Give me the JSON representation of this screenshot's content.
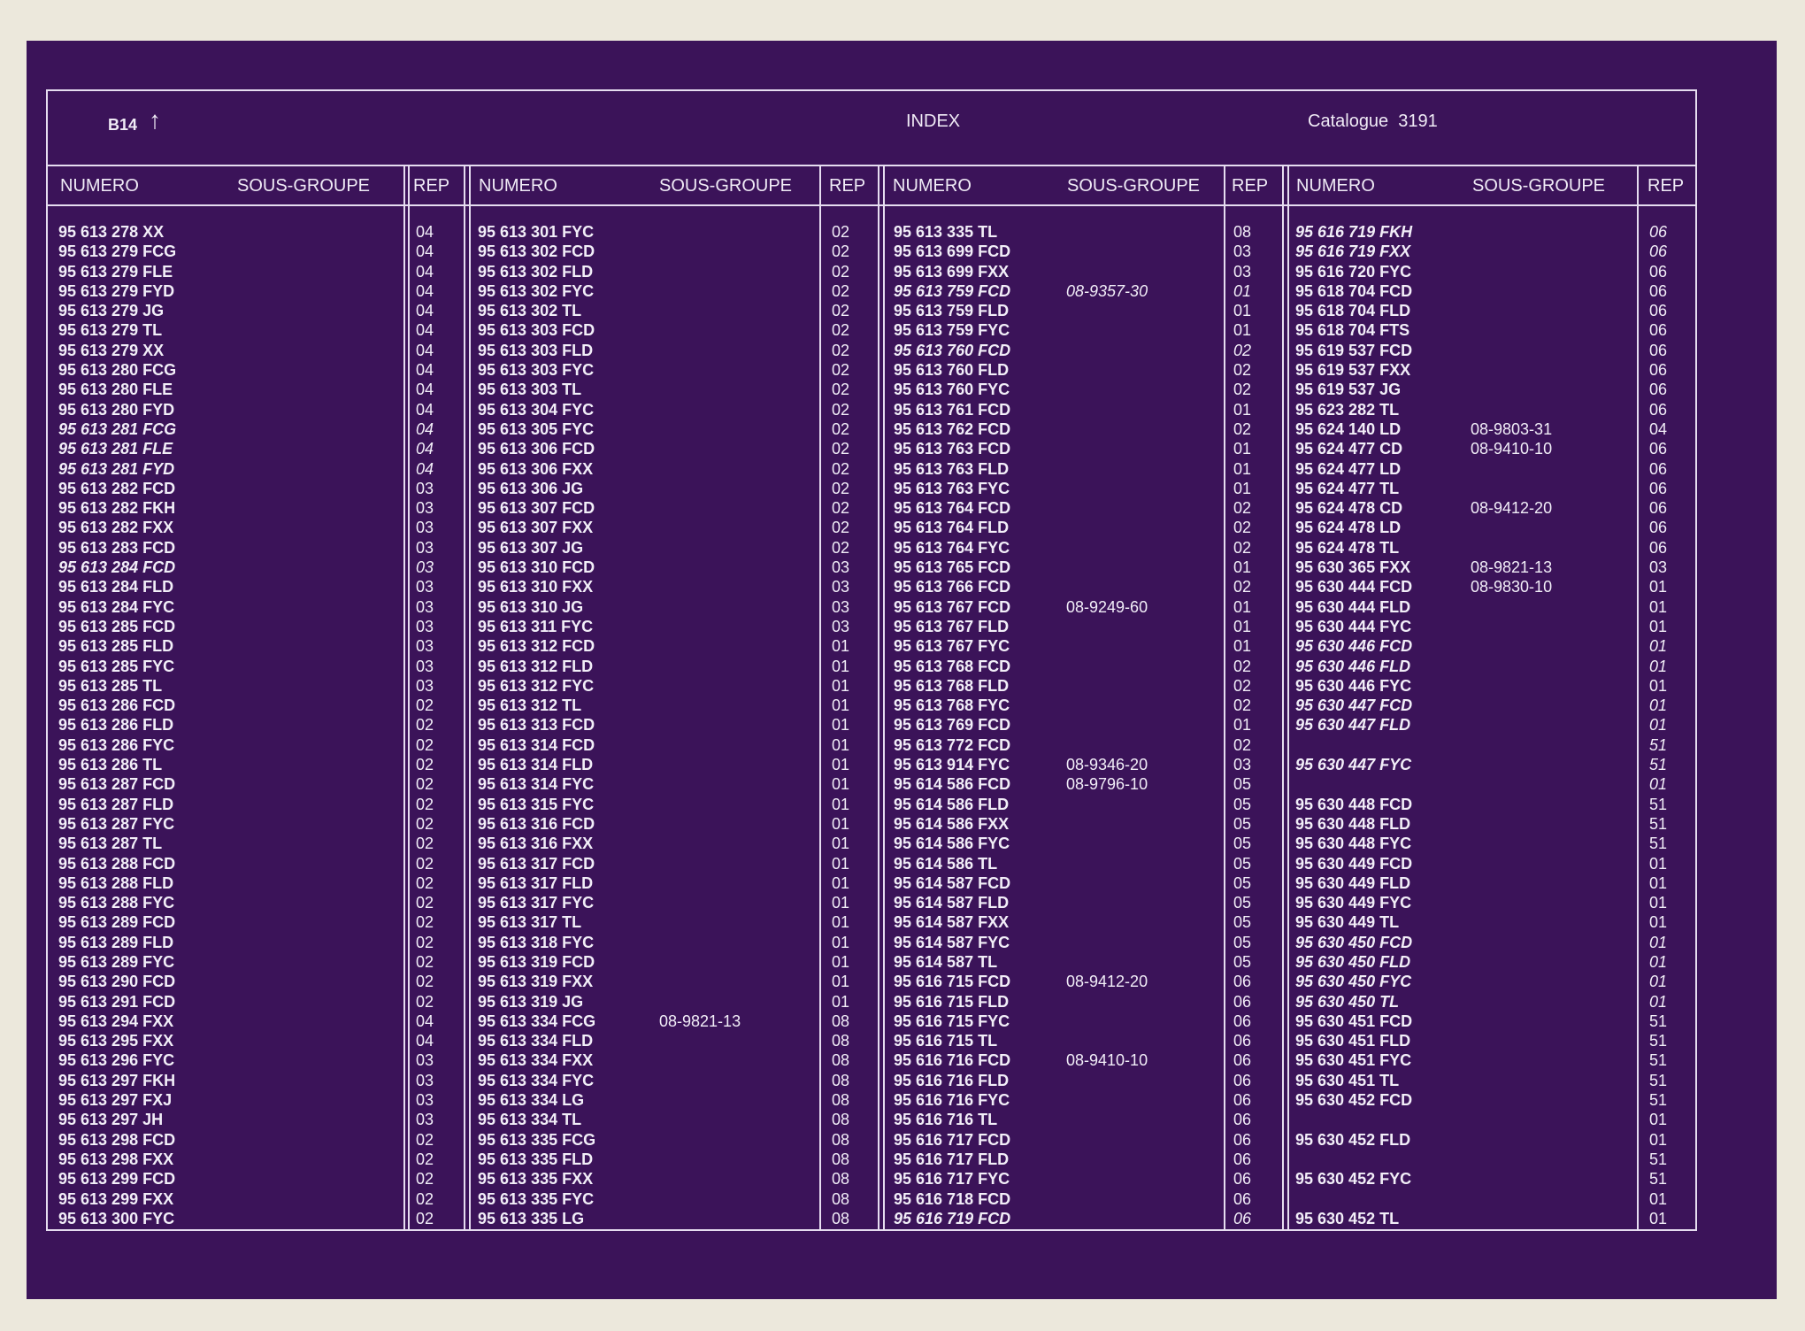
{
  "header": {
    "page_code": "B14",
    "arrow": "↑",
    "title": "INDEX",
    "catalogue": "Catalogue  3191"
  },
  "columns": {
    "numero": "NUMERO",
    "sous_groupe": "SOUS-GROUPE",
    "rep": "REP"
  },
  "col1": [
    {
      "n": "95 613 278 XX",
      "s": "",
      "r": "04"
    },
    {
      "n": "95 613 279 FCG",
      "s": "",
      "r": "04"
    },
    {
      "n": "95 613 279 FLE",
      "s": "",
      "r": "04"
    },
    {
      "n": "95 613 279 FYD",
      "s": "",
      "r": "04"
    },
    {
      "n": "95 613 279 JG",
      "s": "",
      "r": "04"
    },
    {
      "n": "95 613 279 TL",
      "s": "",
      "r": "04"
    },
    {
      "n": "95 613 279 XX",
      "s": "",
      "r": "04"
    },
    {
      "n": "95 613 280 FCG",
      "s": "",
      "r": "04"
    },
    {
      "n": "95 613 280 FLE",
      "s": "",
      "r": "04"
    },
    {
      "n": "95 613 280 FYD",
      "s": "",
      "r": "04"
    },
    {
      "n": "95 613 281 FCG",
      "s": "",
      "r": "04",
      "i": true
    },
    {
      "n": "95 613 281 FLE",
      "s": "",
      "r": "04",
      "i": true
    },
    {
      "n": "95 613 281 FYD",
      "s": "",
      "r": "04",
      "i": true
    },
    {
      "n": "95 613 282 FCD",
      "s": "",
      "r": "03"
    },
    {
      "n": "95 613 282 FKH",
      "s": "",
      "r": "03"
    },
    {
      "n": "95 613 282 FXX",
      "s": "",
      "r": "03"
    },
    {
      "n": "95 613 283 FCD",
      "s": "",
      "r": "03"
    },
    {
      "n": "95 613 284 FCD",
      "s": "",
      "r": "03",
      "i": true
    },
    {
      "n": "95 613 284 FLD",
      "s": "",
      "r": "03"
    },
    {
      "n": "95 613 284 FYC",
      "s": "",
      "r": "03"
    },
    {
      "n": "95 613 285 FCD",
      "s": "",
      "r": "03"
    },
    {
      "n": "95 613 285 FLD",
      "s": "",
      "r": "03"
    },
    {
      "n": "95 613 285 FYC",
      "s": "",
      "r": "03"
    },
    {
      "n": "95 613 285 TL",
      "s": "",
      "r": "03"
    },
    {
      "n": "95 613 286 FCD",
      "s": "",
      "r": "02"
    },
    {
      "n": "95 613 286 FLD",
      "s": "",
      "r": "02"
    },
    {
      "n": "95 613 286 FYC",
      "s": "",
      "r": "02"
    },
    {
      "n": "95 613 286 TL",
      "s": "",
      "r": "02"
    },
    {
      "n": "95 613 287 FCD",
      "s": "",
      "r": "02"
    },
    {
      "n": "95 613 287 FLD",
      "s": "",
      "r": "02"
    },
    {
      "n": "95 613 287 FYC",
      "s": "",
      "r": "02"
    },
    {
      "n": "95 613 287 TL",
      "s": "",
      "r": "02"
    },
    {
      "n": "95 613 288 FCD",
      "s": "",
      "r": "02"
    },
    {
      "n": "95 613 288 FLD",
      "s": "",
      "r": "02"
    },
    {
      "n": "95 613 288 FYC",
      "s": "",
      "r": "02"
    },
    {
      "n": "95 613 289 FCD",
      "s": "",
      "r": "02"
    },
    {
      "n": "95 613 289 FLD",
      "s": "",
      "r": "02"
    },
    {
      "n": "95 613 289 FYC",
      "s": "",
      "r": "02"
    },
    {
      "n": "95 613 290 FCD",
      "s": "",
      "r": "02"
    },
    {
      "n": "95 613 291 FCD",
      "s": "",
      "r": "02"
    },
    {
      "n": "95 613 294 FXX",
      "s": "",
      "r": "04"
    },
    {
      "n": "95 613 295 FXX",
      "s": "",
      "r": "04"
    },
    {
      "n": "95 613 296 FYC",
      "s": "",
      "r": "03"
    },
    {
      "n": "95 613 297 FKH",
      "s": "",
      "r": "03"
    },
    {
      "n": "95 613 297 FXJ",
      "s": "",
      "r": "03"
    },
    {
      "n": "95 613 297 JH",
      "s": "",
      "r": "03"
    },
    {
      "n": "95 613 298 FCD",
      "s": "",
      "r": "02"
    },
    {
      "n": "95 613 298 FXX",
      "s": "",
      "r": "02"
    },
    {
      "n": "95 613 299 FCD",
      "s": "",
      "r": "02"
    },
    {
      "n": "95 613 299 FXX",
      "s": "",
      "r": "02"
    },
    {
      "n": "95 613 300 FYC",
      "s": "",
      "r": "02"
    }
  ],
  "col2": [
    {
      "n": "95 613 301 FYC",
      "s": "",
      "r": "02"
    },
    {
      "n": "95 613 302 FCD",
      "s": "",
      "r": "02"
    },
    {
      "n": "95 613 302 FLD",
      "s": "",
      "r": "02"
    },
    {
      "n": "95 613 302 FYC",
      "s": "",
      "r": "02"
    },
    {
      "n": "95 613 302 TL",
      "s": "",
      "r": "02"
    },
    {
      "n": "95 613 303 FCD",
      "s": "",
      "r": "02"
    },
    {
      "n": "95 613 303 FLD",
      "s": "",
      "r": "02"
    },
    {
      "n": "95 613 303 FYC",
      "s": "",
      "r": "02"
    },
    {
      "n": "95 613 303 TL",
      "s": "",
      "r": "02"
    },
    {
      "n": "95 613 304 FYC",
      "s": "",
      "r": "02"
    },
    {
      "n": "95 613 305 FYC",
      "s": "",
      "r": "02"
    },
    {
      "n": "95 613 306 FCD",
      "s": "",
      "r": "02"
    },
    {
      "n": "95 613 306 FXX",
      "s": "",
      "r": "02"
    },
    {
      "n": "95 613 306 JG",
      "s": "",
      "r": "02"
    },
    {
      "n": "95 613 307 FCD",
      "s": "",
      "r": "02"
    },
    {
      "n": "95 613 307 FXX",
      "s": "",
      "r": "02"
    },
    {
      "n": "95 613 307 JG",
      "s": "",
      "r": "02"
    },
    {
      "n": "95 613 310 FCD",
      "s": "",
      "r": "03"
    },
    {
      "n": "95 613 310 FXX",
      "s": "",
      "r": "03"
    },
    {
      "n": "95 613 310 JG",
      "s": "",
      "r": "03"
    },
    {
      "n": "95 613 311 FYC",
      "s": "",
      "r": "03"
    },
    {
      "n": "95 613 312 FCD",
      "s": "",
      "r": "01"
    },
    {
      "n": "95 613 312 FLD",
      "s": "",
      "r": "01"
    },
    {
      "n": "95 613 312 FYC",
      "s": "",
      "r": "01"
    },
    {
      "n": "95 613 312 TL",
      "s": "",
      "r": "01"
    },
    {
      "n": "95 613 313 FCD",
      "s": "",
      "r": "01"
    },
    {
      "n": "95 613 314 FCD",
      "s": "",
      "r": "01"
    },
    {
      "n": "95 613 314 FLD",
      "s": "",
      "r": "01"
    },
    {
      "n": "95 613 314 FYC",
      "s": "",
      "r": "01"
    },
    {
      "n": "95 613 315 FYC",
      "s": "",
      "r": "01"
    },
    {
      "n": "95 613 316 FCD",
      "s": "",
      "r": "01"
    },
    {
      "n": "95 613 316 FXX",
      "s": "",
      "r": "01"
    },
    {
      "n": "95 613 317 FCD",
      "s": "",
      "r": "01"
    },
    {
      "n": "95 613 317 FLD",
      "s": "",
      "r": "01"
    },
    {
      "n": "95 613 317 FYC",
      "s": "",
      "r": "01"
    },
    {
      "n": "95 613 317 TL",
      "s": "",
      "r": "01"
    },
    {
      "n": "95 613 318 FYC",
      "s": "",
      "r": "01"
    },
    {
      "n": "95 613 319 FCD",
      "s": "",
      "r": "01"
    },
    {
      "n": "95 613 319 FXX",
      "s": "",
      "r": "01"
    },
    {
      "n": "95 613 319 JG",
      "s": "",
      "r": "01"
    },
    {
      "n": "95 613 334 FCG",
      "s": "08-9821-13",
      "r": "08"
    },
    {
      "n": "95 613 334 FLD",
      "s": "",
      "r": "08"
    },
    {
      "n": "95 613 334 FXX",
      "s": "",
      "r": "08"
    },
    {
      "n": "95 613 334 FYC",
      "s": "",
      "r": "08"
    },
    {
      "n": "95 613 334 LG",
      "s": "",
      "r": "08"
    },
    {
      "n": "95 613 334 TL",
      "s": "",
      "r": "08"
    },
    {
      "n": "95 613 335 FCG",
      "s": "",
      "r": "08"
    },
    {
      "n": "95 613 335 FLD",
      "s": "",
      "r": "08"
    },
    {
      "n": "95 613 335 FXX",
      "s": "",
      "r": "08"
    },
    {
      "n": "95 613 335 FYC",
      "s": "",
      "r": "08"
    },
    {
      "n": "95 613 335 LG",
      "s": "",
      "r": "08"
    }
  ],
  "col3": [
    {
      "n": "95 613 335 TL",
      "s": "",
      "r": "08"
    },
    {
      "n": "95 613 699 FCD",
      "s": "",
      "r": "03"
    },
    {
      "n": "95 613 699 FXX",
      "s": "",
      "r": "03"
    },
    {
      "n": "95 613 759 FCD",
      "s": "08-9357-30",
      "r": "01",
      "i": true
    },
    {
      "n": "95 613 759 FLD",
      "s": "",
      "r": "01"
    },
    {
      "n": "95 613 759 FYC",
      "s": "",
      "r": "01"
    },
    {
      "n": "95 613 760 FCD",
      "s": "",
      "r": "02",
      "i": true
    },
    {
      "n": "95 613 760 FLD",
      "s": "",
      "r": "02"
    },
    {
      "n": "95 613 760 FYC",
      "s": "",
      "r": "02"
    },
    {
      "n": "95 613 761 FCD",
      "s": "",
      "r": "01"
    },
    {
      "n": "95 613 762 FCD",
      "s": "",
      "r": "02"
    },
    {
      "n": "95 613 763 FCD",
      "s": "",
      "r": "01"
    },
    {
      "n": "95 613 763 FLD",
      "s": "",
      "r": "01"
    },
    {
      "n": "95 613 763 FYC",
      "s": "",
      "r": "01"
    },
    {
      "n": "95 613 764 FCD",
      "s": "",
      "r": "02"
    },
    {
      "n": "95 613 764 FLD",
      "s": "",
      "r": "02"
    },
    {
      "n": "95 613 764 FYC",
      "s": "",
      "r": "02"
    },
    {
      "n": "95 613 765 FCD",
      "s": "",
      "r": "01"
    },
    {
      "n": "95 613 766 FCD",
      "s": "",
      "r": "02"
    },
    {
      "n": "95 613 767 FCD",
      "s": "08-9249-60",
      "r": "01"
    },
    {
      "n": "95 613 767 FLD",
      "s": "",
      "r": "01"
    },
    {
      "n": "95 613 767 FYC",
      "s": "",
      "r": "01"
    },
    {
      "n": "95 613 768 FCD",
      "s": "",
      "r": "02"
    },
    {
      "n": "95 613 768 FLD",
      "s": "",
      "r": "02"
    },
    {
      "n": "95 613 768 FYC",
      "s": "",
      "r": "02"
    },
    {
      "n": "95 613 769 FCD",
      "s": "",
      "r": "01"
    },
    {
      "n": "95 613 772 FCD",
      "s": "",
      "r": "02"
    },
    {
      "n": "95 613 914 FYC",
      "s": "08-9346-20",
      "r": "03"
    },
    {
      "n": "95 614 586 FCD",
      "s": "08-9796-10",
      "r": "05"
    },
    {
      "n": "95 614 586 FLD",
      "s": "",
      "r": "05"
    },
    {
      "n": "95 614 586 FXX",
      "s": "",
      "r": "05"
    },
    {
      "n": "95 614 586 FYC",
      "s": "",
      "r": "05"
    },
    {
      "n": "95 614 586 TL",
      "s": "",
      "r": "05"
    },
    {
      "n": "95 614 587 FCD",
      "s": "",
      "r": "05"
    },
    {
      "n": "95 614 587 FLD",
      "s": "",
      "r": "05"
    },
    {
      "n": "95 614 587 FXX",
      "s": "",
      "r": "05"
    },
    {
      "n": "95 614 587 FYC",
      "s": "",
      "r": "05"
    },
    {
      "n": "95 614 587 TL",
      "s": "",
      "r": "05"
    },
    {
      "n": "95 616 715 FCD",
      "s": "08-9412-20",
      "r": "06"
    },
    {
      "n": "95 616 715 FLD",
      "s": "",
      "r": "06"
    },
    {
      "n": "95 616 715 FYC",
      "s": "",
      "r": "06"
    },
    {
      "n": "95 616 715 TL",
      "s": "",
      "r": "06"
    },
    {
      "n": "95 616 716 FCD",
      "s": "08-9410-10",
      "r": "06"
    },
    {
      "n": "95 616 716 FLD",
      "s": "",
      "r": "06"
    },
    {
      "n": "95 616 716 FYC",
      "s": "",
      "r": "06"
    },
    {
      "n": "95 616 716 TL",
      "s": "",
      "r": "06"
    },
    {
      "n": "95 616 717 FCD",
      "s": "",
      "r": "06"
    },
    {
      "n": "95 616 717 FLD",
      "s": "",
      "r": "06"
    },
    {
      "n": "95 616 717 FYC",
      "s": "",
      "r": "06"
    },
    {
      "n": "95 616 718 FCD",
      "s": "",
      "r": "06"
    },
    {
      "n": "95 616 719 FCD",
      "s": "",
      "r": "06",
      "i": true
    }
  ],
  "col4": [
    {
      "n": "95 616 719 FKH",
      "s": "",
      "r": "06",
      "i": true
    },
    {
      "n": "95 616 719 FXX",
      "s": "",
      "r": "06",
      "i": true
    },
    {
      "n": "95 616 720 FYC",
      "s": "",
      "r": "06"
    },
    {
      "n": "95 618 704 FCD",
      "s": "",
      "r": "06"
    },
    {
      "n": "95 618 704 FLD",
      "s": "",
      "r": "06"
    },
    {
      "n": "95 618 704 FTS",
      "s": "",
      "r": "06"
    },
    {
      "n": "95 619 537 FCD",
      "s": "",
      "r": "06"
    },
    {
      "n": "95 619 537 FXX",
      "s": "",
      "r": "06"
    },
    {
      "n": "95 619 537 JG",
      "s": "",
      "r": "06"
    },
    {
      "n": "95 623 282 TL",
      "s": "",
      "r": "06"
    },
    {
      "n": "95 624 140 LD",
      "s": "08-9803-31",
      "r": "04"
    },
    {
      "n": "95 624 477 CD",
      "s": "08-9410-10",
      "r": "06"
    },
    {
      "n": "95 624 477 LD",
      "s": "",
      "r": "06"
    },
    {
      "n": "95 624 477 TL",
      "s": "",
      "r": "06"
    },
    {
      "n": "95 624 478 CD",
      "s": "08-9412-20",
      "r": "06"
    },
    {
      "n": "95 624 478 LD",
      "s": "",
      "r": "06"
    },
    {
      "n": "95 624 478 TL",
      "s": "",
      "r": "06"
    },
    {
      "n": "95 630 365 FXX",
      "s": "08-9821-13",
      "r": "03"
    },
    {
      "n": "95 630 444 FCD",
      "s": "08-9830-10",
      "r": "01"
    },
    {
      "n": "95 630 444 FLD",
      "s": "",
      "r": "01"
    },
    {
      "n": "95 630 444 FYC",
      "s": "",
      "r": "01"
    },
    {
      "n": "95 630 446 FCD",
      "s": "",
      "r": "01",
      "i": true
    },
    {
      "n": "95 630 446 FLD",
      "s": "",
      "r": "01",
      "i": true
    },
    {
      "n": "95 630 446 FYC",
      "s": "",
      "r": "01"
    },
    {
      "n": "95 630 447 FCD",
      "s": "",
      "r": "01",
      "i": true
    },
    {
      "n": "95 630 447 FLD",
      "s": "",
      "r": "01",
      "i": true
    },
    {
      "n": "",
      "s": "",
      "r": "51",
      "i": true
    },
    {
      "n": "95 630 447 FYC",
      "s": "",
      "r": "51",
      "i": true
    },
    {
      "n": "",
      "s": "",
      "r": "01",
      "i": true
    },
    {
      "n": "95 630 448 FCD",
      "s": "",
      "r": "51"
    },
    {
      "n": "95 630 448 FLD",
      "s": "",
      "r": "51"
    },
    {
      "n": "95 630 448 FYC",
      "s": "",
      "r": "51"
    },
    {
      "n": "95 630 449 FCD",
      "s": "",
      "r": "01"
    },
    {
      "n": "95 630 449 FLD",
      "s": "",
      "r": "01"
    },
    {
      "n": "95 630 449 FYC",
      "s": "",
      "r": "01"
    },
    {
      "n": "95 630 449 TL",
      "s": "",
      "r": "01"
    },
    {
      "n": "95 630 450 FCD",
      "s": "",
      "r": "01",
      "i": true
    },
    {
      "n": "95 630 450 FLD",
      "s": "",
      "r": "01",
      "i": true
    },
    {
      "n": "95 630 450 FYC",
      "s": "",
      "r": "01",
      "i": true
    },
    {
      "n": "95 630 450 TL",
      "s": "",
      "r": "01",
      "i": true
    },
    {
      "n": "95 630 451 FCD",
      "s": "",
      "r": "51"
    },
    {
      "n": "95 630 451 FLD",
      "s": "",
      "r": "51"
    },
    {
      "n": "95 630 451 FYC",
      "s": "",
      "r": "51"
    },
    {
      "n": "95 630 451 TL",
      "s": "",
      "r": "51"
    },
    {
      "n": "95 630 452 FCD",
      "s": "",
      "r": "51"
    },
    {
      "n": "",
      "s": "",
      "r": "01"
    },
    {
      "n": "95 630 452 FLD",
      "s": "",
      "r": "01"
    },
    {
      "n": "",
      "s": "",
      "r": "51"
    },
    {
      "n": "95 630 452 FYC",
      "s": "",
      "r": "51"
    },
    {
      "n": "",
      "s": "",
      "r": "01"
    },
    {
      "n": "95 630 452 TL",
      "s": "",
      "r": "01"
    }
  ]
}
